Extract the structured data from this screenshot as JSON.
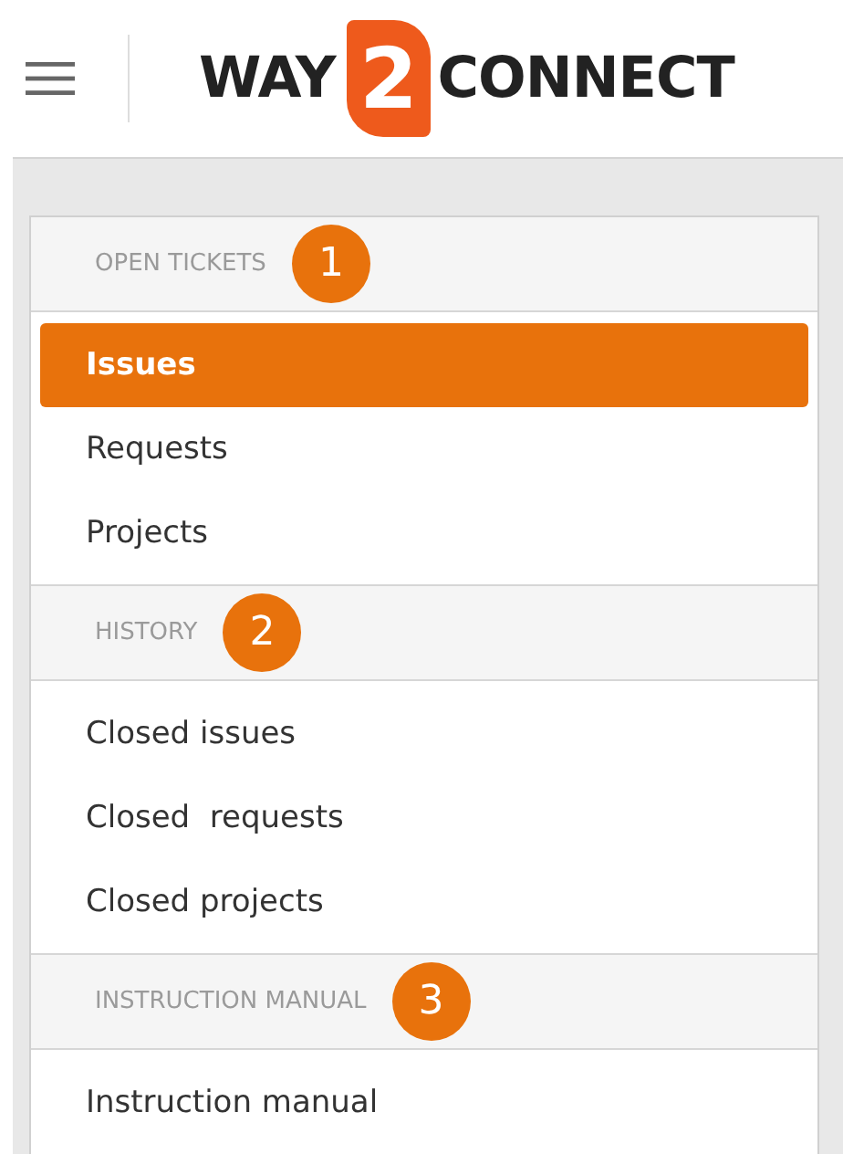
{
  "header": {
    "logo": {
      "left": "WAY",
      "mark": "2",
      "right": "CONNECT"
    }
  },
  "sections": [
    {
      "title": "OPEN TICKETS",
      "badge": "1",
      "items": [
        {
          "label": "Issues",
          "selected": true
        },
        {
          "label": "Requests",
          "selected": false
        },
        {
          "label": "Projects",
          "selected": false
        }
      ]
    },
    {
      "title": "HISTORY",
      "badge": "2",
      "items": [
        {
          "label": "Closed issues",
          "selected": false
        },
        {
          "label": "Closed  requests",
          "selected": false
        },
        {
          "label": "Closed projects",
          "selected": false
        }
      ]
    },
    {
      "title": "INSTRUCTION MANUAL",
      "badge": "3",
      "items": [
        {
          "label": "Instruction manual",
          "selected": false
        }
      ]
    }
  ]
}
